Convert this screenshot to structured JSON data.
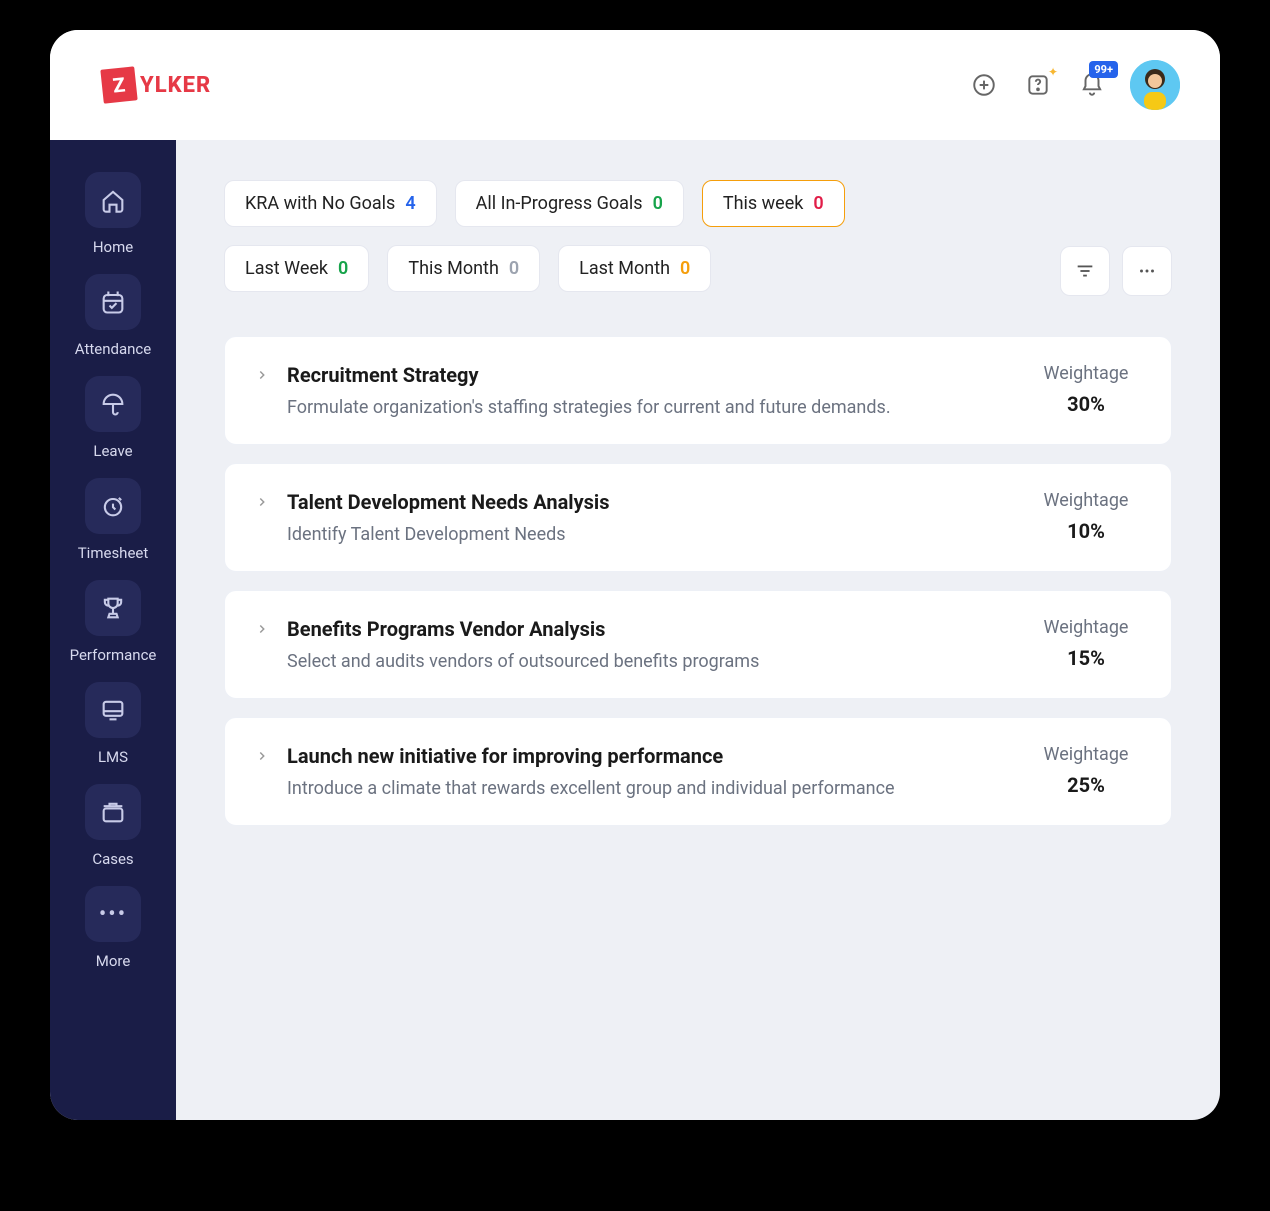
{
  "brand": {
    "initial": "Z",
    "name": "YLKER"
  },
  "notifications": {
    "badge": "99+"
  },
  "sidebar": {
    "items": [
      {
        "label": "Home",
        "icon": "home"
      },
      {
        "label": "Attendance",
        "icon": "calendar"
      },
      {
        "label": "Leave",
        "icon": "umbrella"
      },
      {
        "label": "Timesheet",
        "icon": "clock"
      },
      {
        "label": "Performance",
        "icon": "trophy"
      },
      {
        "label": "LMS",
        "icon": "monitor"
      },
      {
        "label": "Cases",
        "icon": "briefcase"
      },
      {
        "label": "More",
        "icon": "more"
      }
    ]
  },
  "filters": {
    "chips": [
      {
        "label": "KRA with No Goals",
        "count": "4",
        "color": "blue",
        "active": false
      },
      {
        "label": "All In-Progress Goals",
        "count": "0",
        "color": "green",
        "active": false
      },
      {
        "label": "This week",
        "count": "0",
        "color": "red",
        "active": true
      },
      {
        "label": "Last Week",
        "count": "0",
        "color": "green",
        "active": false
      },
      {
        "label": "This Month",
        "count": "0",
        "color": "grey",
        "active": false
      },
      {
        "label": "Last Month",
        "count": "0",
        "color": "orange",
        "active": false
      }
    ]
  },
  "weightage_label": "Weightage",
  "kras": [
    {
      "title": "Recruitment Strategy",
      "desc": "Formulate organization's staffing strategies for current and future demands.",
      "weight": "30%"
    },
    {
      "title": "Talent Development Needs Analysis",
      "desc": "Identify Talent Development Needs",
      "weight": "10%"
    },
    {
      "title": "Benefits Programs Vendor Analysis",
      "desc": "Select and audits vendors of outsourced benefits programs",
      "weight": "15%"
    },
    {
      "title": "Launch new initiative for improving performance",
      "desc": "Introduce a climate that rewards excellent group and individual performance",
      "weight": "25%"
    }
  ]
}
